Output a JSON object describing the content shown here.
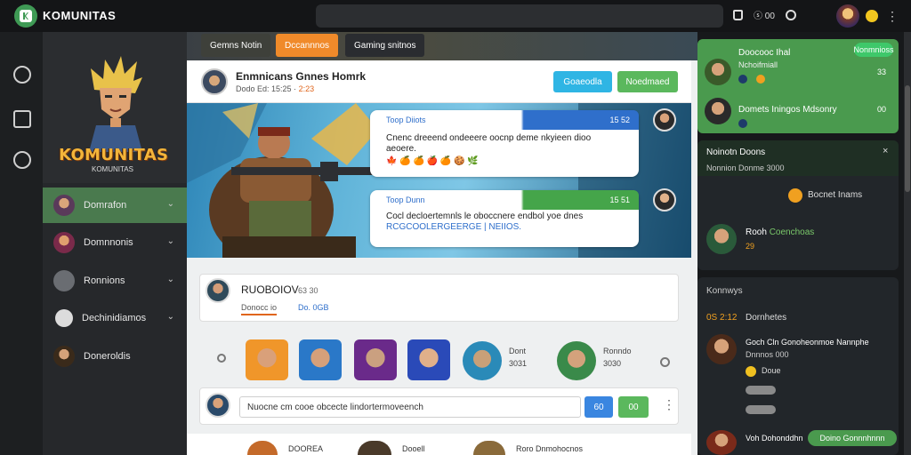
{
  "app": {
    "brand": "KOMUNITAS"
  },
  "topbar": {
    "icon_label": "00"
  },
  "hero": {
    "title": "KOMUNITAS",
    "subtitle": "KOMUNITAS"
  },
  "sidebar": {
    "items": [
      {
        "label": "Domrafon",
        "active": true
      },
      {
        "label": "Domnnonis",
        "active": false
      },
      {
        "label": "Ronnions",
        "active": false
      },
      {
        "label": "Dechinidiamos",
        "active": false
      },
      {
        "label": "Doneroldis",
        "active": false
      }
    ]
  },
  "tabs": [
    {
      "label": "Gemns Notin"
    },
    {
      "label": "Dccannnos"
    },
    {
      "label": "Gaming snitnos"
    }
  ],
  "post": {
    "author": "Enmnicans Gnnes Homrk",
    "meta_prefix": "Dodo Ed: 15:25 ·",
    "meta_highlight": "2:23",
    "btn_primary": "Goaeodla",
    "btn_secondary": "Noedmaed"
  },
  "chat": [
    {
      "header": "Toop Diiots",
      "time": "15 52",
      "text": "Cnenc dreeend ondeeere oocnp deme nkyieen dioo aeoere.",
      "emoji": "🍁 🍊 🍊 🍎 🍊 🍪 🌿"
    },
    {
      "header": "Toop Dunn",
      "time": "15 51",
      "text": "Cocl decloertemnls le oboccnere endbol yoe dnes",
      "text2": "RCGCOOLERGEERGE | NEIIOS."
    }
  ],
  "profile": {
    "name": "RUOBOIOV",
    "meta1": "63 30",
    "meta2": "Donocc io",
    "meta3": "Do. 0GB"
  },
  "chips": {
    "label_a": "Dont",
    "count_a": "3031",
    "label_b": "Ronndo",
    "count_b": "3030"
  },
  "comment": {
    "placeholder": "Nuocne cm cooe obcecte lindortermoveench",
    "btn_a": "60",
    "btn_b": "00"
  },
  "bottom": {
    "items": [
      "DOOREA",
      "Dooell",
      "Roro Dnmohocnos"
    ]
  },
  "right": {
    "top": {
      "title": "Doocooc Ihal",
      "sub": "Nchoifmiall",
      "online": "Nonmnioss",
      "count": "33",
      "row2": "Domets Iningos Mdsonry",
      "row2_n": "00"
    },
    "panel": {
      "title": "Noinotn Doons",
      "sub": "Nonnion Donme  3000",
      "chip": "Bocnet Inams",
      "name": "Rooh",
      "name_hl": "Coenchoas",
      "name_n": "29"
    },
    "feed": {
      "title": "Konnwys",
      "line1_n": "0S 2:12",
      "line1": "Dornhetes",
      "line2": "Goch Cln Gonoheonmoe Nannphe",
      "line2_sub": "Dnnnos 000",
      "reacts": "Doue",
      "line3": "Voh Dohonddhn",
      "pill": "Doino   Gonnnhnnn"
    }
  }
}
